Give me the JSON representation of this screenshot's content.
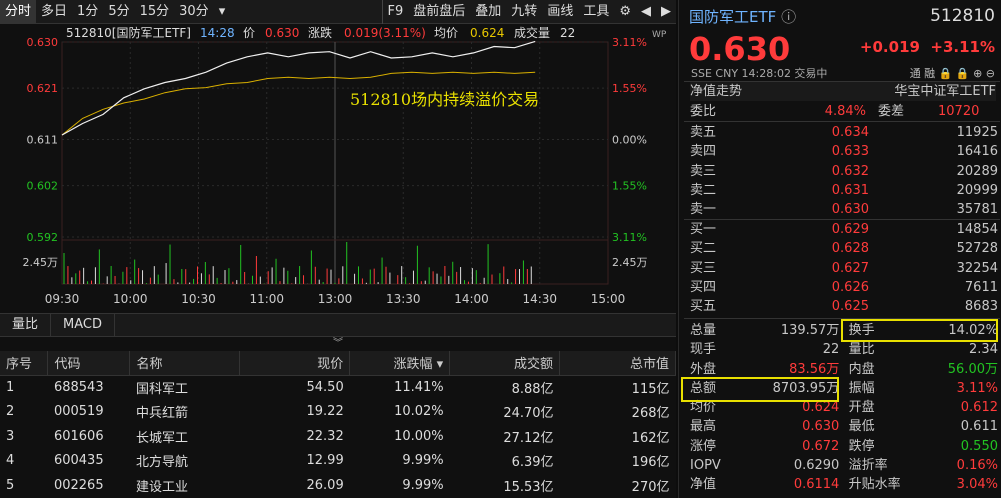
{
  "toolbar": {
    "items": [
      "分时",
      "多日",
      "1分",
      "5分",
      "15分",
      "30分",
      "▾"
    ],
    "right": [
      "F9",
      "盘前盘后",
      "叠加",
      "九转",
      "画线",
      "工具"
    ]
  },
  "chart": {
    "header": {
      "name": "512810[国防军工ETF]",
      "time": "14:28",
      "price_label": "价",
      "price": "0.630",
      "chg_label": "涨跌",
      "chg": "0.019(3.11%)",
      "avg_label": "均价",
      "avg": "0.624",
      "vol_label": "成交量",
      "vol": "22"
    },
    "y_left": [
      "0.630",
      "0.621",
      "0.611",
      "0.602",
      "0.592"
    ],
    "y_right": [
      "3.11%",
      "1.55%",
      "0.00%",
      "1.55%",
      "3.11%"
    ],
    "vol_label": "2.45万",
    "x_labels": [
      "09:30",
      "10:00",
      "10:30",
      "11:00",
      "13:00",
      "13:30",
      "14:00",
      "14:30",
      "15:00"
    ],
    "annotation": "512810场内持续溢价交易",
    "wp_badge": "WP"
  },
  "chart_data": {
    "type": "line",
    "y_range": [
      0.592,
      0.63
    ],
    "price_series": [
      0.612,
      0.614,
      0.616,
      0.619,
      0.621,
      0.622,
      0.623,
      0.624,
      0.626,
      0.627,
      0.628,
      0.627,
      0.628,
      0.628,
      0.627,
      0.628,
      0.627,
      0.627,
      0.628,
      0.627,
      0.628,
      0.629,
      0.629,
      0.63
    ],
    "avg_series": [
      0.612,
      0.615,
      0.617,
      0.618,
      0.619,
      0.62,
      0.621,
      0.621,
      0.622,
      0.622,
      0.623,
      0.623,
      0.623,
      0.623,
      0.623,
      0.623,
      0.624,
      0.624,
      0.624,
      0.624,
      0.624,
      0.624,
      0.624,
      0.624
    ]
  },
  "subtabs": [
    "量比",
    "MACD"
  ],
  "table": {
    "headers": [
      "序号",
      "代码",
      "名称",
      "现价",
      "涨跌幅 ▾",
      "成交额",
      "总市值"
    ],
    "rows": [
      [
        "1",
        "688543",
        "国科军工",
        "54.50",
        "11.41%",
        "8.88亿",
        "115亿"
      ],
      [
        "2",
        "000519",
        "中兵红箭",
        "19.22",
        "10.02%",
        "24.70亿",
        "268亿"
      ],
      [
        "3",
        "601606",
        "长城军工",
        "22.32",
        "10.00%",
        "27.12亿",
        "162亿"
      ],
      [
        "4",
        "600435",
        "北方导航",
        "12.99",
        "9.99%",
        "6.39亿",
        "196亿"
      ],
      [
        "5",
        "002265",
        "建设工业",
        "26.09",
        "9.99%",
        "15.53亿",
        "270亿"
      ]
    ]
  },
  "quote": {
    "name": "国防军工ETF",
    "code": "512810",
    "price": "0.630",
    "chg": "+0.019",
    "pct": "+3.11%",
    "meta": "SSE  CNY  14:28:02  交易中",
    "flags": "通  融  🔒  🔒  ⊕  ⊖",
    "nav_label": "净值走势",
    "fund_label": "华宝中证军工ETF",
    "webi": [
      "委比",
      "4.84%",
      "委差",
      "10720"
    ],
    "asks": [
      [
        "卖五",
        "0.634",
        "11925"
      ],
      [
        "卖四",
        "0.633",
        "16416"
      ],
      [
        "卖三",
        "0.632",
        "20289"
      ],
      [
        "卖二",
        "0.631",
        "20999"
      ],
      [
        "卖一",
        "0.630",
        "35781"
      ]
    ],
    "bids": [
      [
        "买一",
        "0.629",
        "14854"
      ],
      [
        "买二",
        "0.628",
        "52728"
      ],
      [
        "买三",
        "0.627",
        "32254"
      ],
      [
        "买四",
        "0.626",
        "7611"
      ],
      [
        "买五",
        "0.625",
        "8683"
      ]
    ],
    "stats": [
      [
        "总量",
        "139.57万",
        "换手",
        "14.02%"
      ],
      [
        "现手",
        "22",
        "量比",
        "2.34"
      ],
      [
        "外盘",
        "83.56万",
        "内盘",
        "56.00万"
      ],
      [
        "总额",
        "8703.95万",
        "振幅",
        "3.11%"
      ],
      [
        "均价",
        "0.624",
        "开盘",
        "0.612"
      ],
      [
        "最高",
        "0.630",
        "最低",
        "0.611"
      ],
      [
        "涨停",
        "0.672",
        "跌停",
        "0.550"
      ],
      [
        "IOPV",
        "0.6290",
        "溢折率",
        "0.16%"
      ],
      [
        "净值",
        "0.6114",
        "升贴水率",
        "3.04%"
      ]
    ]
  }
}
